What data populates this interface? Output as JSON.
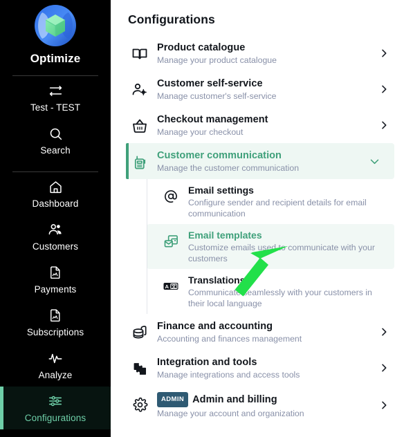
{
  "sidebar": {
    "brand": {
      "name": "Optimize",
      "logo_icon": "optimize-logo"
    },
    "items": [
      {
        "label": "Test - TEST",
        "icon": "transfer-icon",
        "active": false
      },
      {
        "label": "Search",
        "icon": "search-icon",
        "active": false
      },
      {
        "label": "Dashboard",
        "icon": "home-icon",
        "active": false
      },
      {
        "label": "Customers",
        "icon": "users-icon",
        "active": false
      },
      {
        "label": "Payments",
        "icon": "document-chart-icon",
        "active": false
      },
      {
        "label": "Subscriptions",
        "icon": "document-chart-icon",
        "active": false
      },
      {
        "label": "Analyze",
        "icon": "pulse-icon",
        "active": false
      },
      {
        "label": "Configurations",
        "icon": "sliders-icon",
        "active": true
      }
    ]
  },
  "main": {
    "title": "Configurations",
    "rows": [
      {
        "title": "Product catalogue",
        "subtitle": "Manage your product catalogue",
        "icon": "book-icon",
        "chevron": "chevron-right-icon"
      },
      {
        "title": "Customer self-service",
        "subtitle": "Manage customer's self-service",
        "icon": "user-gear-icon",
        "chevron": "chevron-right-icon"
      },
      {
        "title": "Checkout management",
        "subtitle": "Manage your checkout",
        "icon": "basket-icon",
        "chevron": "chevron-right-icon"
      }
    ],
    "expanded": {
      "title": "Customer communication",
      "subtitle": "Manage the customer communication",
      "icon": "radio-icon",
      "chevron": "chevron-down-icon",
      "children": [
        {
          "title": "Email settings",
          "subtitle": "Configure sender and recipient details for email communication",
          "icon": "at-sign-icon",
          "selected": false
        },
        {
          "title": "Email templates",
          "subtitle": "Customize emails used to communicate with your customers",
          "icon": "email-templates-icon",
          "selected": true
        },
        {
          "title": "Translations",
          "subtitle": "Communicate seamlessly with your customers in their local language",
          "icon": "translate-icon",
          "selected": false
        }
      ]
    },
    "rows_bottom": [
      {
        "title": "Finance and accounting",
        "subtitle": "Accounting and finances management",
        "icon": "coins-stack-icon",
        "chevron": "chevron-right-icon"
      },
      {
        "title": "Integration and tools",
        "subtitle": "Manage integrations and access tools",
        "icon": "puzzle-icon",
        "chevron": "chevron-right-icon"
      },
      {
        "title": "Admin and billing",
        "subtitle": "Manage your account and organization",
        "icon": "gear-icon",
        "badge": "ADMIN",
        "chevron": "chevron-right-icon"
      }
    ]
  },
  "annotation": {
    "arrow": "green-pointer-arrow",
    "color": "#22e04a"
  },
  "colors": {
    "sidebar_bg": "#000000",
    "accent_green": "#6ecfa8",
    "title_green": "#3fa07a",
    "highlight_bg": "#eef7f3",
    "subtitle_gray": "#8890a8",
    "badge_bg": "#2f5a73"
  }
}
